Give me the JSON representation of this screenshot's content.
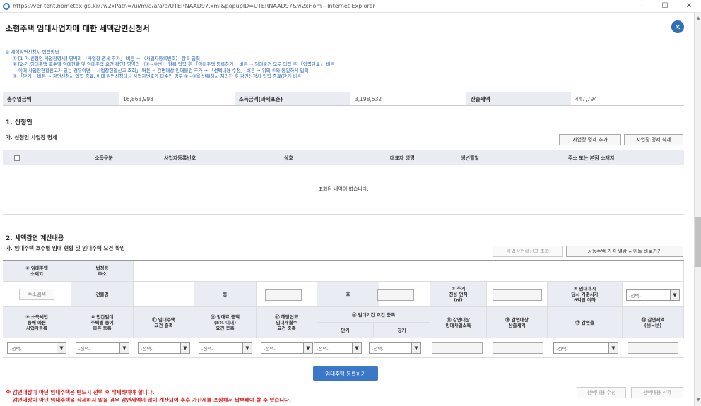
{
  "window": {
    "url": "https://ver-teht.hometax.go.kr/?w2xPath=/ui/m/a/a/a/a/UTERNAAD97.xml&popupID=UTERNAAD97&w2xHom - Internet Explorer",
    "minimize": "–",
    "maximize": "☐",
    "close": "✕"
  },
  "page": {
    "title": "소형주택 임대사업자에 대한 세액감면신청서",
    "close_icon": "✕"
  },
  "guide": {
    "lines": [
      "※ 세액감면신청서 입력방법",
      "① [1-가.신청인 사업장명세] 영역의 「사업장 명세 추가」 버튼 → 〈사업자등록번호〉 항목 입력",
      "② [2-가.임대주택 호수별 임대현황 및 임대주택 요건 확인] 영역의 〈⑥~⑩번〉 항목 입력 후 「임대주택 등록하기」 버튼 → 임대물건 모두 입력 후 「입력완료」 버튼",
      "이때 사업장현황신고가 있는 경우이면 「사업장현황신고 조회」 버튼 → 감면대상 임대물건 추가 → 「선택내용 수정」 버튼 → 위의 ②와 동일하게 입력",
      "③ 「닫기」 버튼 → 감면신청서 입력 종료, 이때 감면신청대상 사업자번호가 다수인 경우 ①~③을 반복해서 처리한 후 감면신청서 입력 종료(닫기 버튼)"
    ]
  },
  "summary": {
    "total_income_label": "총수입금액",
    "total_income_value": "16,863,998",
    "income_amount_label": "소득금액(과세표준)",
    "income_amount_value": "3,198,532",
    "tax_label": "산출세액",
    "tax_value": "447,794"
  },
  "section1": {
    "title": "1. 신청인",
    "sub": "가. 신청인 사업장 명세",
    "add_button": "사업장 명세 추가",
    "delete_button": "사업장 명세 삭제",
    "columns": [
      "소득구분",
      "사업자등록번호",
      "상호",
      "대표자 성명",
      "생년월일",
      "주소 또는 본점 소재지"
    ],
    "empty": "조회된 내역이 없습니다."
  },
  "section2": {
    "title": "2. 세액감면 계산내용",
    "sub": "가. 임대주택 호수별 임대 현황 및 임대주택 요건 확인",
    "lookup_button": "사업장현황신고 조회",
    "site_button": "공동주택 가격 열람 사이트 바로가기",
    "row1": {
      "location": "⑥ 임대주택\n소재지",
      "legal_address": "법정동\n주소",
      "search_button": "주소검색",
      "building": "건물명",
      "dong": "동",
      "ho": "호",
      "area": "⑦ 주거\n전용 면적\n(㎡)",
      "price": "⑧ 임대개시\n당시 기준시가\n6억원 이하"
    },
    "row2": {
      "c9": "⑨ 소득세법\n등에 따른\n사업자등록",
      "c10": "⑩ 민간임대\n주택법 등에\n따른 등록",
      "c11": "⑪ 임대주택\n요건 충족",
      "c12": "⑫ 임대료 증액\n(5% 이내)\n요건 충족",
      "c13": "⑬ 해당연도\n임대개월수\n요건 충족",
      "c14": "⑭ 임대기간 요건 충족",
      "short": "단기",
      "long": "장기",
      "c15": "⑮ 감면대상\n임대사업소득",
      "c16": "⑯ 감면대상\n산출세액",
      "c17": "⑰ 감면율",
      "c18": "⑱ 감면세액\n(⑯×⑰)"
    },
    "select_placeholder": "-선택-",
    "register_button": "임대주택 등록하기",
    "edit_button": "선택내용 수정",
    "delete_button": "선택내용 삭제"
  },
  "warnings": [
    "※ 감면대상이 아닌 임대주택은 반드시 선택 후 삭제하여야 합니다.",
    "감면대상이 아닌 임대주택을 삭제하지 않을 경우 감면세액이 많이 계산되어 추후 가산세를 포함해서 납부해야 할 수 있습니다."
  ]
}
